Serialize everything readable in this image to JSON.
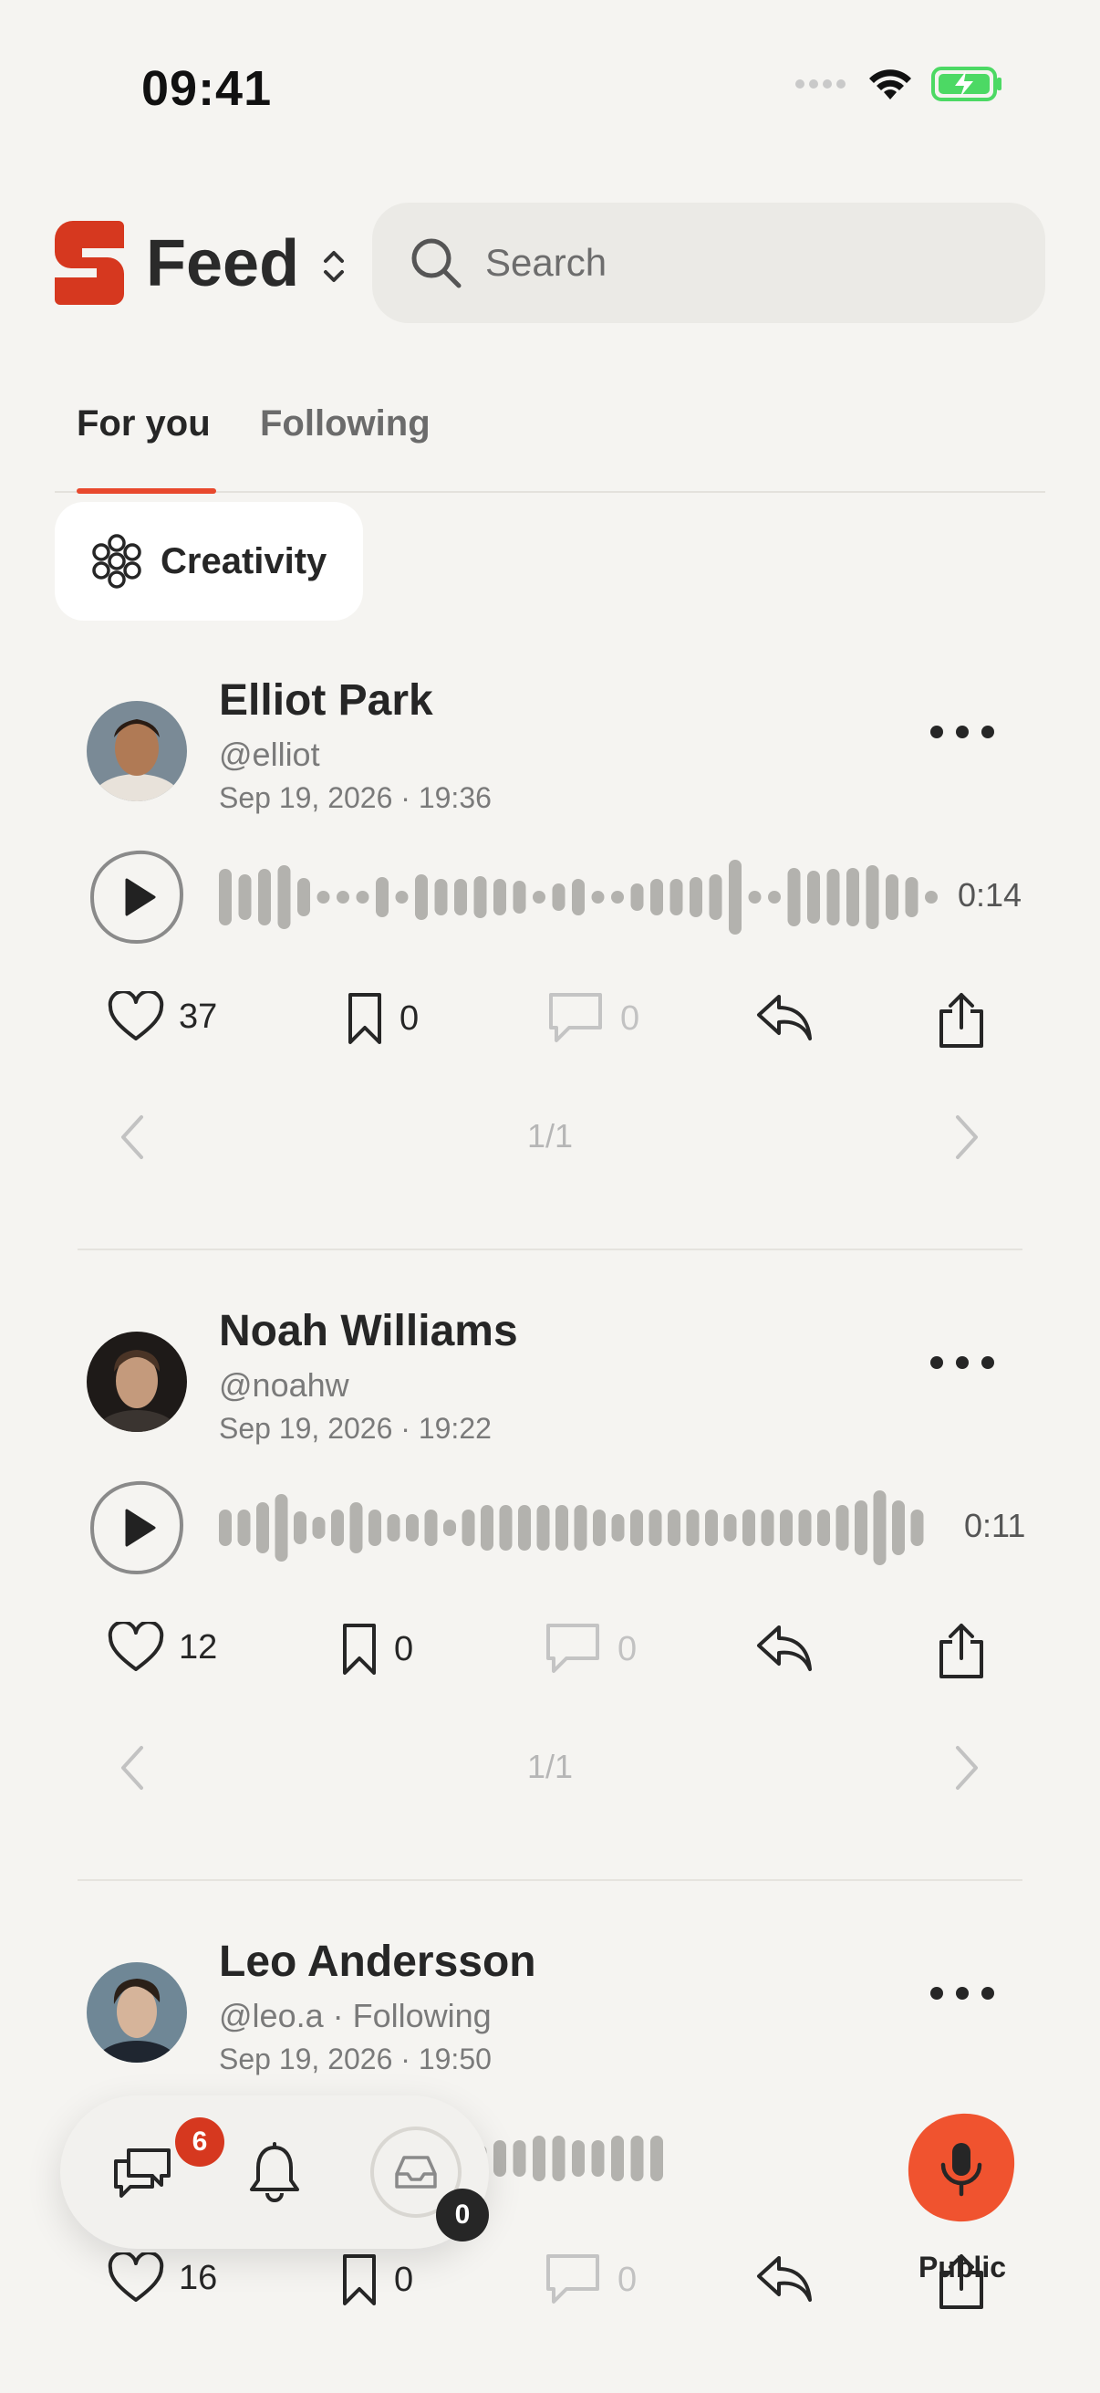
{
  "status_bar": {
    "time": "09:41"
  },
  "header": {
    "title": "Feed",
    "search_placeholder": "Search"
  },
  "tabs": [
    {
      "label": "For you",
      "active": true
    },
    {
      "label": "Following",
      "active": false
    }
  ],
  "filter_chip": {
    "label": "Creativity"
  },
  "posts": [
    {
      "author": "Elliot Park",
      "handle": "@elliot",
      "date": "Sep 19, 2026 · 19:36",
      "duration": "0:14",
      "likes": "37",
      "bookmarks": "0",
      "comments": "0",
      "page": "1/1"
    },
    {
      "author": "Noah Williams",
      "handle": "@noahw",
      "date": "Sep 19, 2026 · 19:22",
      "duration": "0:11",
      "likes": "12",
      "bookmarks": "0",
      "comments": "0",
      "page": "1/1"
    },
    {
      "author": "Leo Andersson",
      "handle": "@leo.a · Following",
      "date": "Sep 19, 2026 · 19:50",
      "likes": "16",
      "bookmarks": "0",
      "comments": "0"
    }
  ],
  "bottom_nav": {
    "messages_badge": "6",
    "inbox_badge": "0"
  },
  "record": {
    "label": "Public"
  },
  "colors": {
    "accent": "#e8492d",
    "record": "#f0532f",
    "brand": "#d6381f"
  }
}
